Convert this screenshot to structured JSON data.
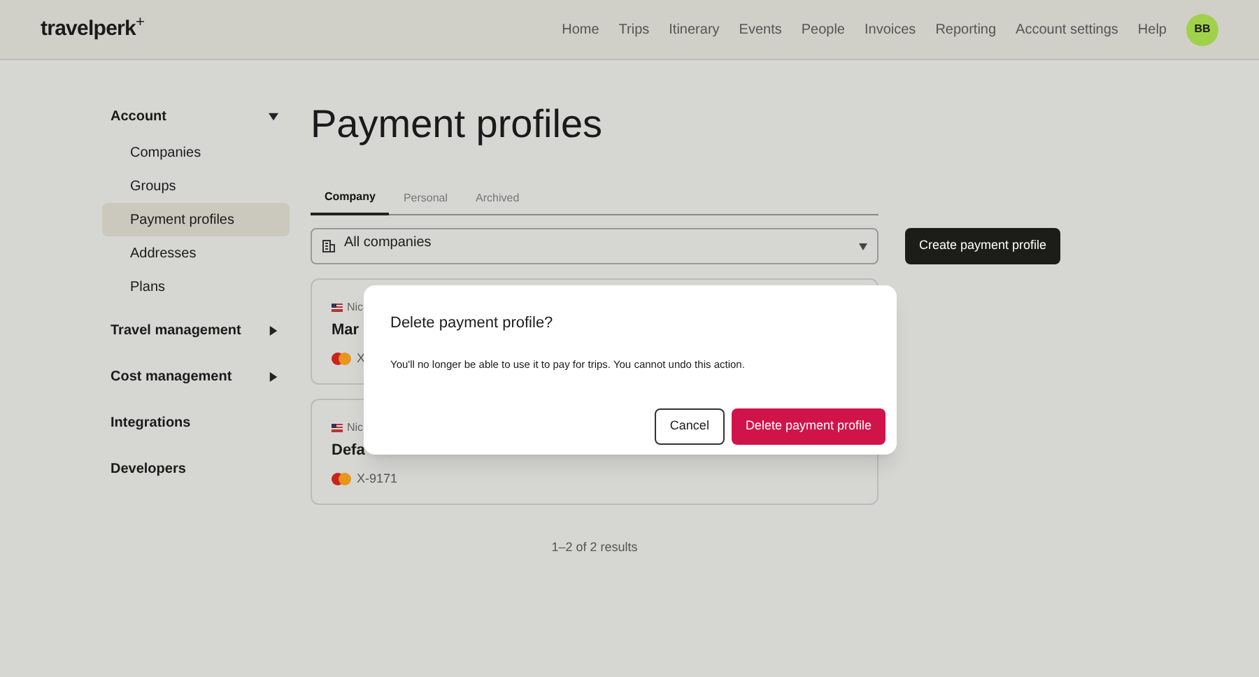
{
  "header": {
    "logo": "travelperk",
    "logo_mark": "+",
    "nav": [
      "Home",
      "Trips",
      "Itinerary",
      "Events",
      "People",
      "Invoices",
      "Reporting",
      "Account settings",
      "Help"
    ],
    "avatar": "BB"
  },
  "sidebar": {
    "items": [
      {
        "label": "Account",
        "expanded": true,
        "children": [
          {
            "label": "Companies",
            "selected": false
          },
          {
            "label": "Groups",
            "selected": false
          },
          {
            "label": "Payment profiles",
            "selected": true
          },
          {
            "label": "Addresses",
            "selected": false
          },
          {
            "label": "Plans",
            "selected": false
          }
        ]
      },
      {
        "label": "Travel management",
        "expanded": false
      },
      {
        "label": "Cost management",
        "expanded": false
      },
      {
        "label": "Integrations"
      },
      {
        "label": "Developers"
      }
    ]
  },
  "page_title": "Payment profiles",
  "tabs": [
    {
      "label": "Company",
      "selected": true
    },
    {
      "label": "Personal",
      "selected": false
    },
    {
      "label": "Archived",
      "selected": false
    }
  ],
  "company_select": {
    "value": "All companies"
  },
  "create_button": "Create payment profile",
  "profiles": [
    {
      "owner": "Nic",
      "name": "Mar",
      "card": "X"
    },
    {
      "owner": "Nic",
      "name": "Defa",
      "card": "X-9171"
    }
  ],
  "results": "1–2 of 2 results",
  "dialog": {
    "title": "Delete payment profile?",
    "message": "You'll no longer be able to use it to pay for trips. You cannot undo this action.",
    "cancel": "Cancel",
    "confirm": "Delete payment profile"
  }
}
